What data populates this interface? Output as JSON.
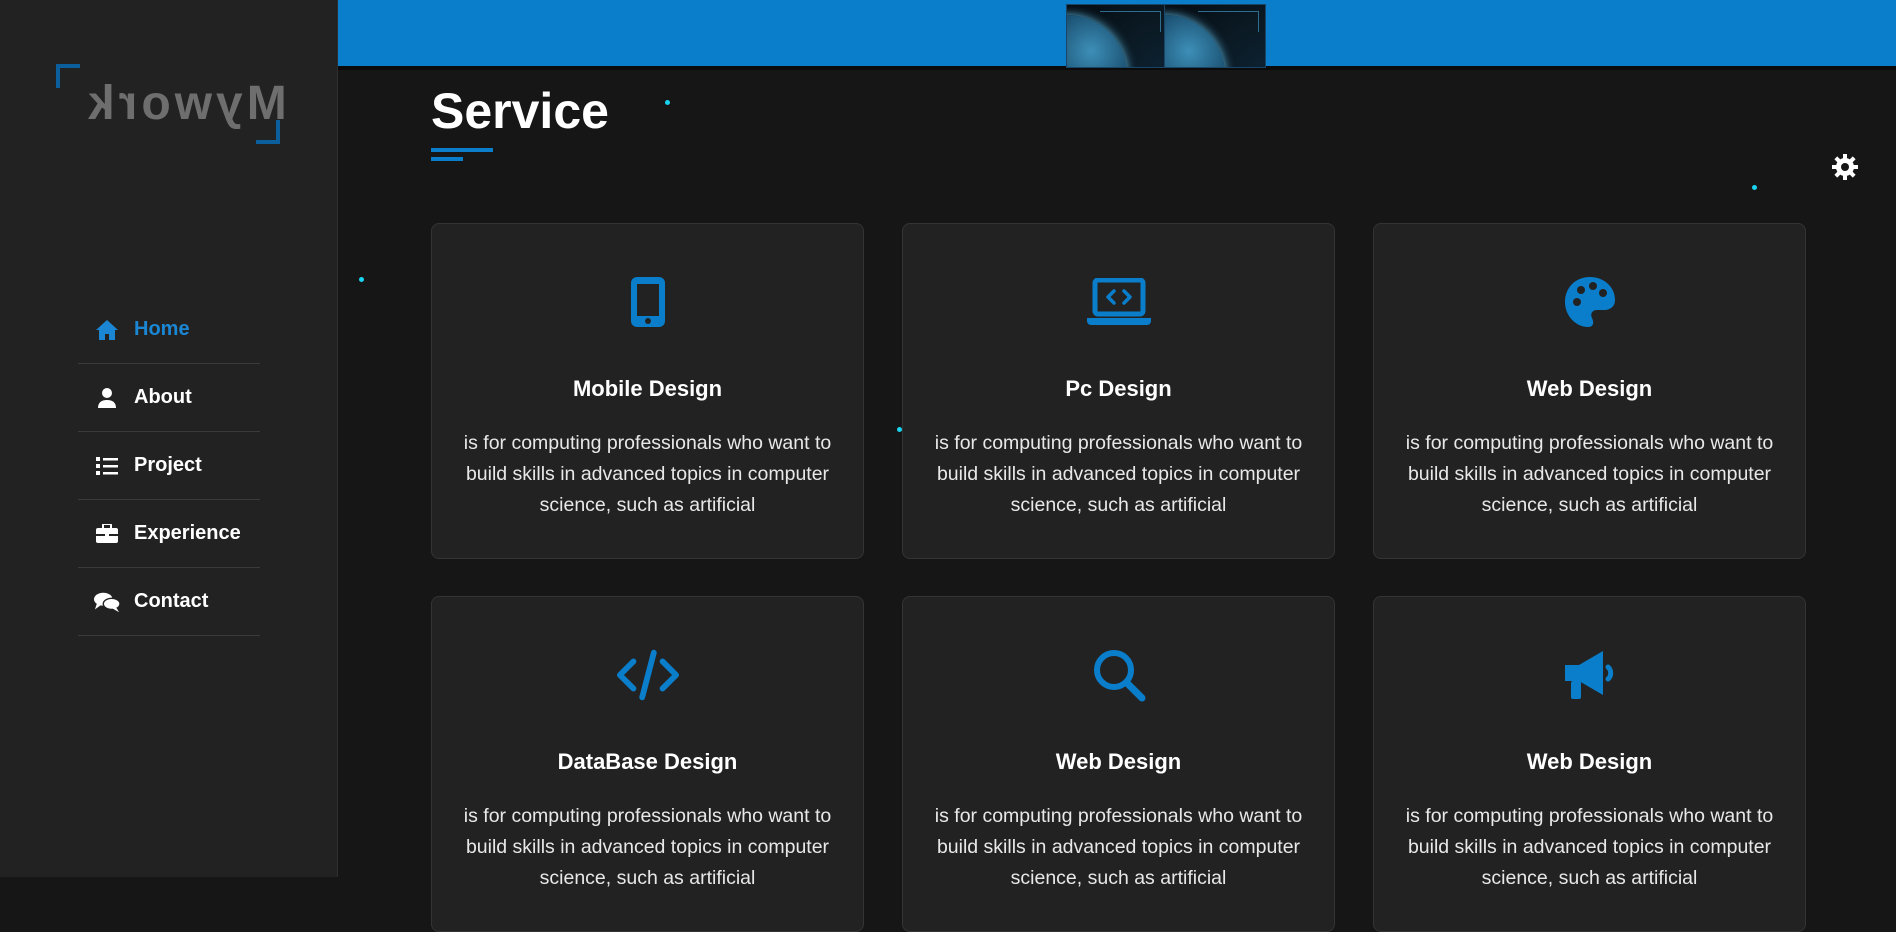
{
  "brand": {
    "logo_text": "Mywork"
  },
  "nav": {
    "items": [
      {
        "label": "Home",
        "icon": "home-icon",
        "active": true
      },
      {
        "label": "About",
        "icon": "user-icon",
        "active": false
      },
      {
        "label": "Project",
        "icon": "list-icon",
        "active": false
      },
      {
        "label": "Experience",
        "icon": "briefcase-icon",
        "active": false
      },
      {
        "label": "Contact",
        "icon": "comments-icon",
        "active": false
      }
    ]
  },
  "section": {
    "title": "Service"
  },
  "cards": [
    {
      "title": "Mobile Design",
      "icon": "mobile-icon",
      "description": "is for computing professionals who want to build skills in advanced topics in computer science, such as artificial"
    },
    {
      "title": "Pc Design",
      "icon": "laptop-code-icon",
      "description": "is for computing professionals who want to build skills in advanced topics in computer science, such as artificial"
    },
    {
      "title": "Web Design",
      "icon": "palette-icon",
      "description": "is for computing professionals who want to build skills in advanced topics in computer science, such as artificial"
    },
    {
      "title": "DataBase Design",
      "icon": "code-icon",
      "description": "is for computing professionals who want to build skills in advanced topics in computer science, such as artificial"
    },
    {
      "title": "Web Design",
      "icon": "search-icon",
      "description": "is for computing professionals who want to build skills in advanced topics in computer science, such as artificial"
    },
    {
      "title": "Web Design",
      "icon": "megaphone-icon",
      "description": "is for computing professionals who want to build skills in advanced topics in computer science, such as artificial"
    }
  ],
  "colors": {
    "accent": "#0a7ecb",
    "sidebar_bg": "#222222",
    "page_bg": "#161616",
    "card_bg": "#222222",
    "particle": "#19d4f0"
  }
}
